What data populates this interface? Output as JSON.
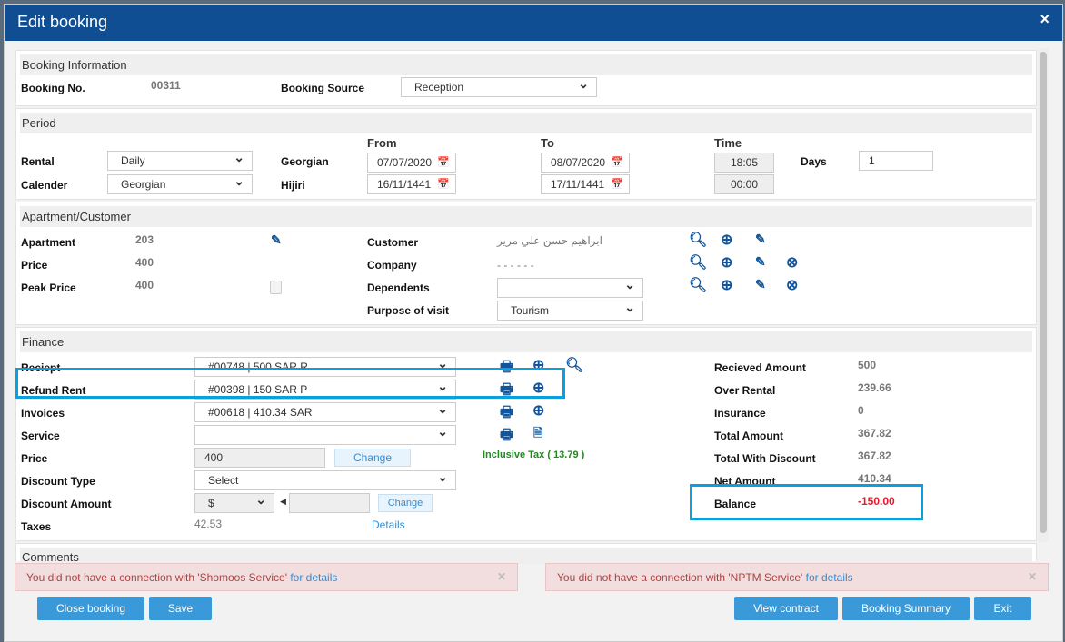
{
  "dialog": {
    "title": "Edit booking",
    "close": "×"
  },
  "booking": {
    "header": "Booking Information",
    "no_label": "Booking No.",
    "no": "00311",
    "source_label": "Booking Source",
    "source": "Reception"
  },
  "period": {
    "header": "Period",
    "from": "From",
    "to": "To",
    "time": "Time",
    "rental_label": "Rental",
    "rental": "Daily",
    "calendar_label": "Calender",
    "calendar": "Georgian",
    "georgian_label": "Georgian",
    "hijiri_label": "Hijiri",
    "from_g": "07/07/2020",
    "from_h": "16/11/1441",
    "to_g": "08/07/2020",
    "to_h": "17/11/1441",
    "time_g": "18:05",
    "time_h": "00:00",
    "days_label": "Days",
    "days": "1"
  },
  "apt": {
    "header": "Apartment/Customer",
    "apartment_label": "Apartment",
    "apartment": "203",
    "price_label": "Price",
    "price": "400",
    "peak_label": "Peak Price",
    "peak": "400",
    "customer_label": "Customer",
    "customer": "ابراهيم حسن علي مرير",
    "company_label": "Company",
    "company": "- - - - - -",
    "dependents_label": "Dependents",
    "dependents": "",
    "purpose_label": "Purpose of visit",
    "purpose": "Tourism"
  },
  "finance": {
    "header": "Finance",
    "receipt_label": "Reciept",
    "receipt": "#00748 | 500 SAR R",
    "refund_label": "Refund Rent",
    "refund": "#00398 | 150 SAR P",
    "invoices_label": "Invoices",
    "invoices": "#00618 | 410.34 SAR",
    "service_label": "Service",
    "service": "",
    "price_label": "Price",
    "price": "400",
    "change": "Change",
    "inclusive_tax": "Inclusive Tax ( 13.79 )",
    "discount_type_label": "Discount Type",
    "discount_type": "Select",
    "discount_amount_label": "Discount Amount",
    "currency": "$",
    "discount_amount": "",
    "taxes_label": "Taxes",
    "taxes": "42.53",
    "details": "Details",
    "summary": [
      {
        "label": "Recieved Amount",
        "value": "500"
      },
      {
        "label": "Over Rental",
        "value": "239.66"
      },
      {
        "label": "Insurance",
        "value": "0"
      },
      {
        "label": "Total Amount",
        "value": "367.82"
      },
      {
        "label": "Total With Discount",
        "value": "367.82"
      },
      {
        "label": "Net Amount",
        "value": "410.34"
      },
      {
        "label": "Balance",
        "value": "-150.00"
      }
    ],
    "balance_color": "#e8192c"
  },
  "comments": {
    "header": "Comments"
  },
  "alerts": [
    {
      "text": "You did not have a connection with 'Shomoos Service'",
      "link": "for details"
    },
    {
      "text": "You did not have a connection with 'NPTM Service'",
      "link": "for details"
    }
  ],
  "buttons": {
    "close_booking": "Close booking",
    "save": "Save",
    "view_contract": "View contract",
    "summary": "Booking Summary",
    "exit": "Exit"
  }
}
